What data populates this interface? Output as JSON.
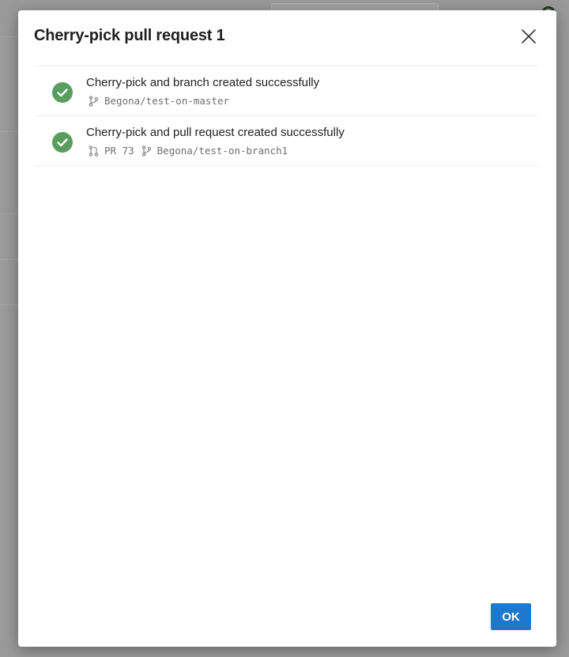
{
  "dialog": {
    "title": "Cherry-pick pull request 1",
    "close_icon": "close-icon",
    "ok_label": "OK"
  },
  "results": [
    {
      "title": "Cherry-pick and branch created successfully",
      "status_icon": "check-circle-icon",
      "branch": "Begona/test-on-master"
    },
    {
      "title": "Cherry-pick and pull request created successfully",
      "status_icon": "check-circle-icon",
      "pr": "PR 73",
      "branch": "Begona/test-on-branch1"
    }
  ],
  "colors": {
    "success": "#5a9e5f",
    "primary_button": "#1e78d0",
    "overlay": "#9a9a9a"
  }
}
